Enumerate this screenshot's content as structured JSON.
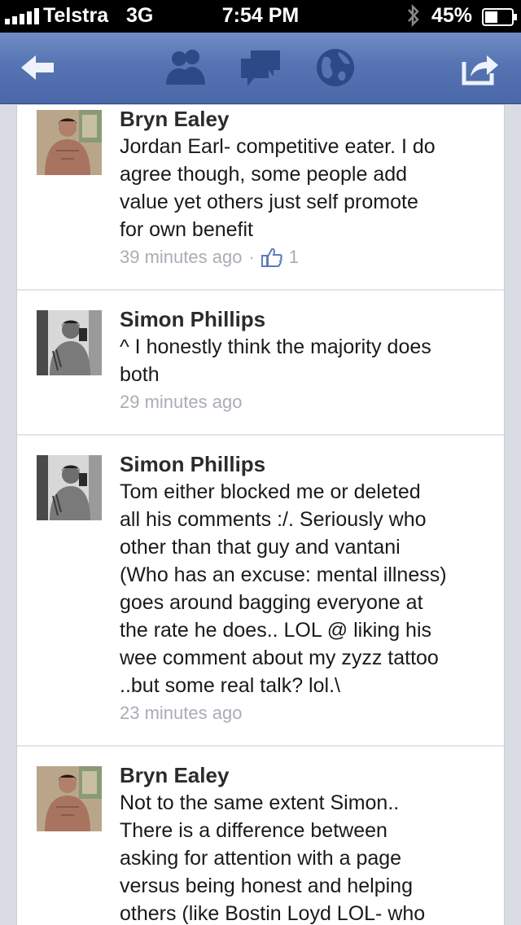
{
  "status_bar": {
    "carrier": "Telstra",
    "network": "3G",
    "time": "7:54 PM",
    "battery_percent": "45%"
  },
  "nav_bar": {
    "icons": [
      "back-arrow-icon",
      "friends-icon",
      "messages-icon",
      "globe-notifications-icon",
      "share-icon"
    ],
    "color": "#5674b3"
  },
  "comments": [
    {
      "author": "Bryn Ealey",
      "lines": [
        "Jordan Earl- competitive eater. I do",
        "agree though, some people add",
        "value yet others just self promote",
        "for own benefit"
      ],
      "time": "39 minutes ago",
      "separator": "·",
      "likes": "1"
    },
    {
      "author": "Simon Phillips",
      "lines": [
        "^ I honestly think the majority does",
        "both"
      ],
      "time": "29 minutes ago"
    },
    {
      "author": "Simon Phillips",
      "lines": [
        "Tom either blocked me or deleted",
        "all his comments :/. Seriously who",
        "other than that guy and vantani",
        "(Who has an excuse: mental illness)",
        "goes around bagging everyone at",
        "the rate he does.. LOL @ liking his",
        "wee comment about my zyzz tattoo",
        "..but some real talk? lol.\\"
      ],
      "time": "23 minutes ago"
    },
    {
      "author": "Bryn Ealey",
      "lines": [
        "Not to the same extent Simon..",
        "There is a difference between",
        "asking for attention with a page",
        "versus being honest and helping",
        "others (like Bostin Loyd LOL- who"
      ]
    }
  ]
}
